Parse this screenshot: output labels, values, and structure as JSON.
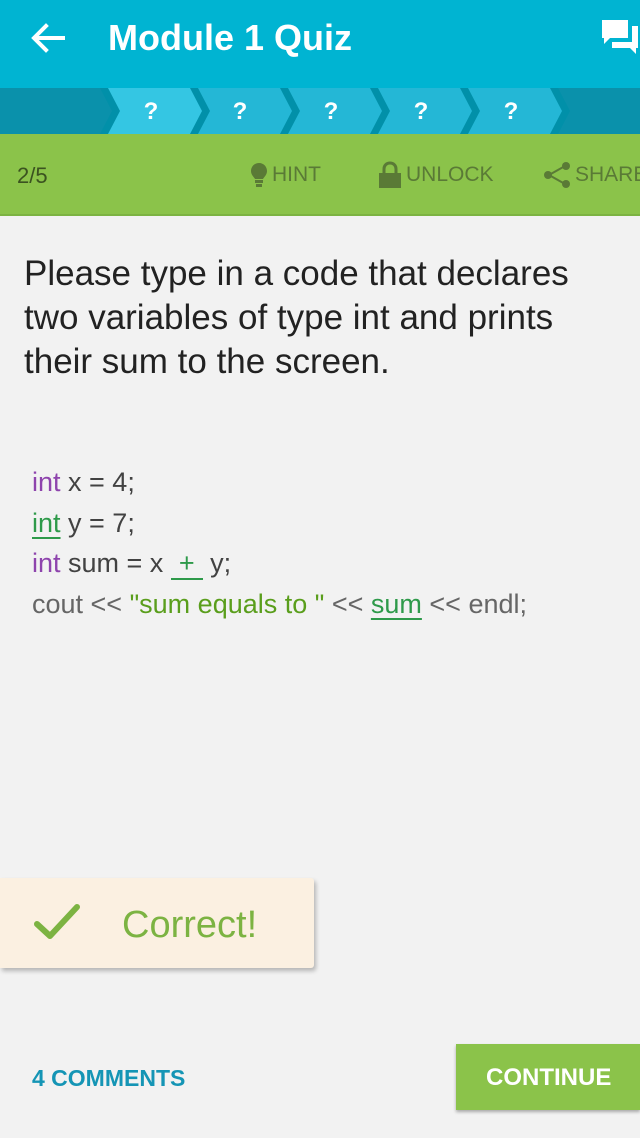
{
  "appbar": {
    "title": "Module 1 Quiz",
    "back_icon": "arrow-left-icon",
    "discuss_icon": "chat-bubbles-icon",
    "color": "#00b4d2"
  },
  "progress": {
    "steps": [
      "?",
      "?",
      "?",
      "?",
      "?"
    ],
    "current_step": 2
  },
  "actions": {
    "counter": "2/5",
    "hint": "HINT",
    "unlock": "UNLOCK",
    "share": "SHARE"
  },
  "question": {
    "text": "Please type in a code that declares two variables of type int and prints their sum to the screen."
  },
  "code": {
    "line1": {
      "kw": "int",
      "rest": " x = 4;"
    },
    "line2": {
      "kw": "int",
      "rest": " y = 7;"
    },
    "line3": {
      "kw": "int",
      "pre": " sum = x ",
      "answer": "+",
      "post": " y;"
    },
    "line4": {
      "pre": "cout << ",
      "str": "\"sum equals to \"",
      "mid": " << ",
      "answer": "sum",
      "post": " << endl;"
    }
  },
  "result": {
    "text": "Correct!",
    "icon": "check-icon",
    "color": "#7cb342"
  },
  "footer": {
    "comments": "4 COMMENTS",
    "continue": "CONTINUE"
  }
}
